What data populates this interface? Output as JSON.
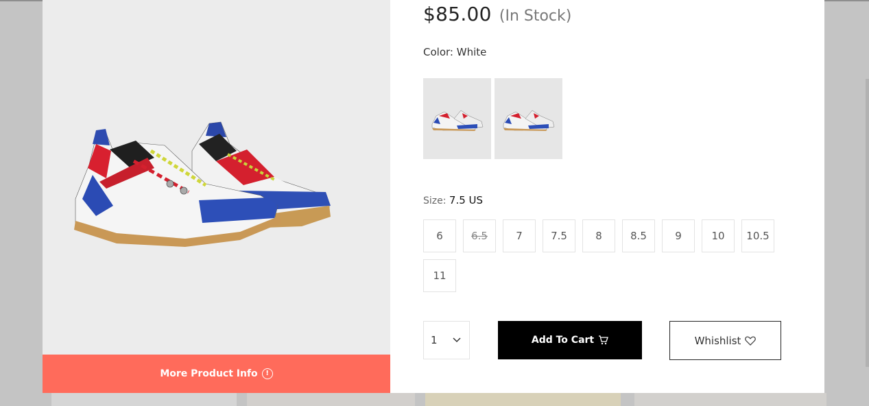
{
  "product": {
    "price": "$85.00",
    "stock_status": "(In Stock)",
    "color_label": "Color:",
    "color_value": "White",
    "size_label": "Size:",
    "size_value": "7.5 US",
    "sizes": [
      {
        "label": "6",
        "available": true
      },
      {
        "label": "6.5",
        "available": false
      },
      {
        "label": "7",
        "available": true
      },
      {
        "label": "7.5",
        "available": true
      },
      {
        "label": "8",
        "available": true
      },
      {
        "label": "8.5",
        "available": true
      },
      {
        "label": "9",
        "available": true
      },
      {
        "label": "10",
        "available": true
      },
      {
        "label": "10.5",
        "available": true
      },
      {
        "label": "11",
        "available": true
      }
    ],
    "quantity": "1"
  },
  "buttons": {
    "more_info": "More Product Info",
    "add_to_cart": "Add To Cart",
    "wishlist": "Whishlist"
  },
  "icons": {
    "info": "info-circle-icon",
    "cart": "cart-icon",
    "heart": "heart-icon",
    "chevron": "chevron-down-icon"
  },
  "colors": {
    "accent": "#ff6b5b",
    "cart_button": "#000000",
    "image_background": "#ececec"
  }
}
